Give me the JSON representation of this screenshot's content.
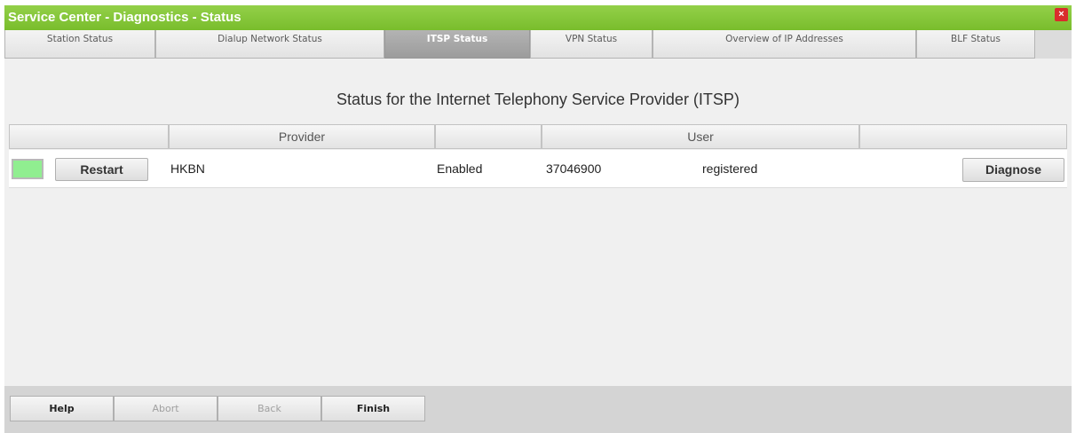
{
  "window": {
    "title": "Service Center - Diagnostics - Status",
    "close_icon": "×"
  },
  "tabs": [
    {
      "label": "Station Status"
    },
    {
      "label": "Dialup Network Status"
    },
    {
      "label": "ITSP Status"
    },
    {
      "label": "VPN Status"
    },
    {
      "label": "Overview of IP Addresses"
    },
    {
      "label": "BLF Status"
    }
  ],
  "main": {
    "heading": "Status for the Internet Telephony Service Provider (ITSP)",
    "columns": [
      "",
      "Provider",
      "",
      "User",
      ""
    ],
    "rows": [
      {
        "status_color": "#90ee90",
        "restart_label": "Restart",
        "provider": "HKBN",
        "state": "Enabled",
        "user": "37046900",
        "registration": "registered",
        "diagnose_label": "Diagnose"
      }
    ]
  },
  "footer": {
    "help": "Help",
    "abort": "Abort",
    "back": "Back",
    "finish": "Finish"
  },
  "colors": {
    "accent": "#79bd2c",
    "close": "#d92c2c",
    "status_ok": "#90ee90"
  }
}
